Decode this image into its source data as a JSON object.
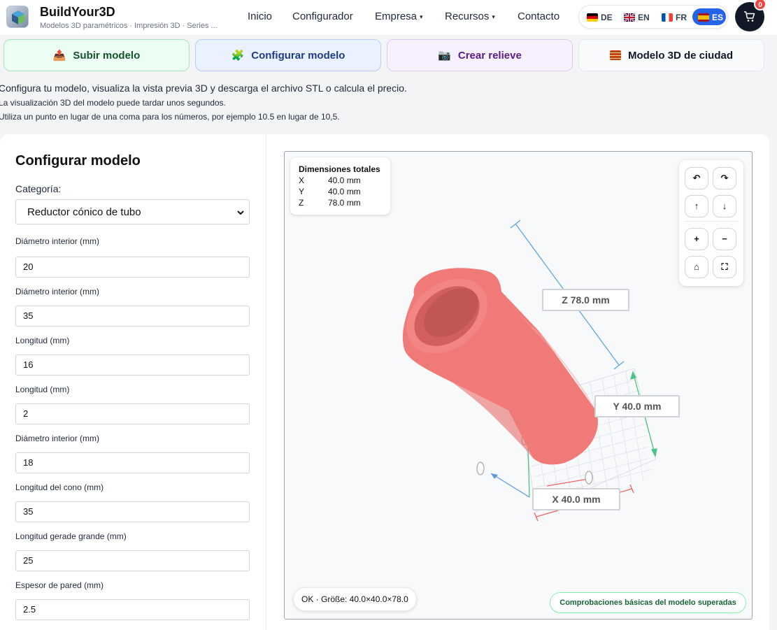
{
  "header": {
    "brand": "BuildYour3D",
    "tagline": "Modelos 3D paramétricos · Impresión 3D · Series ...",
    "nav": [
      {
        "label": "Inicio"
      },
      {
        "label": "Configurador"
      },
      {
        "label": "Empresa",
        "caret": "▾"
      },
      {
        "label": "Recursos",
        "caret": "▾"
      },
      {
        "label": "Contacto"
      }
    ],
    "languages": [
      {
        "code": "DE",
        "active": false
      },
      {
        "code": "EN",
        "active": false
      },
      {
        "code": "FR",
        "active": false
      },
      {
        "code": "ES",
        "active": true
      }
    ],
    "cart_count": "0"
  },
  "tabs": [
    {
      "label": "Subir modelo",
      "icon": "upload-icon"
    },
    {
      "label": "Configurar modelo",
      "icon": "puzzle-icon"
    },
    {
      "label": "Crear relieve",
      "icon": "camera-icon"
    },
    {
      "label": "Modelo 3D de ciudad",
      "icon": "bricks-icon"
    }
  ],
  "intro": {
    "line1": "Configura tu modelo, visualiza la vista previa 3D y descarga el archivo STL o calcula el precio.",
    "line2": "La visualización 3D del modelo puede tardar unos segundos.",
    "line3": "Utiliza un punto en lugar de una coma para los números, por ejemplo 10.5 en lugar de 10,5."
  },
  "form": {
    "title": "Configurar modelo",
    "category_label": "Categoría:",
    "category_value": "Reductor cónico de tubo",
    "fields": [
      {
        "label": "Diámetro interior (mm)",
        "value": "20"
      },
      {
        "label": "Diámetro interior (mm)",
        "value": "35"
      },
      {
        "label": "Longitud (mm)",
        "value": "16"
      },
      {
        "label": "Longitud (mm)",
        "value": "2"
      },
      {
        "label": "Diámetro interior (mm)",
        "value": "18"
      },
      {
        "label": "Longitud del cono (mm)",
        "value": "35"
      },
      {
        "label": "Longitud gerade grande (mm)",
        "value": "25"
      },
      {
        "label": "Espesor de pared (mm)",
        "value": "2.5"
      }
    ]
  },
  "viewer": {
    "dims_title": "Dimensiones totales",
    "dims": [
      {
        "axis": "X",
        "value": "40.0 mm"
      },
      {
        "axis": "Y",
        "value": "40.0 mm"
      },
      {
        "axis": "Z",
        "value": "78.0 mm"
      }
    ],
    "labels": {
      "z": "Z 78.0 mm",
      "y": "Y 40.0 mm",
      "x": "X 40.0 mm"
    },
    "status": "OK · Größe: 40.0×40.0×78.0",
    "check": "Comprobaciones básicas del modelo superadas",
    "controls": [
      "↶",
      "↷",
      "↑",
      "↓",
      "+",
      "−",
      "⌂",
      "⛶"
    ],
    "model_color": "#f07a78"
  }
}
